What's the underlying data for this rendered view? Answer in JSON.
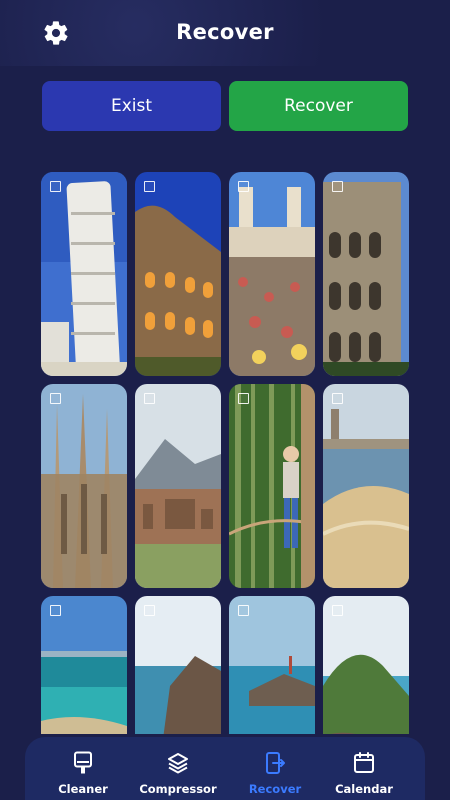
{
  "header": {
    "title": "Recover",
    "settings_icon": "gear-icon"
  },
  "actions": {
    "exist_label": "Exist",
    "recover_label": "Recover"
  },
  "colors": {
    "background": "#1b1f4a",
    "exist_button": "#2b38b0",
    "recover_button": "#23a547",
    "nav_background": "#1e2a63",
    "active_tab": "#3b7bff"
  },
  "gallery": {
    "photos": [
      {
        "subject": "leaning-tower-of-pisa",
        "selected": false
      },
      {
        "subject": "colosseum-at-dusk",
        "selected": false
      },
      {
        "subject": "spanish-steps-crowd",
        "selected": false
      },
      {
        "subject": "colosseum-facade",
        "selected": false
      },
      {
        "subject": "sagrada-familia",
        "selected": false
      },
      {
        "subject": "pompeii-ruins-vesuvius",
        "selected": false
      },
      {
        "subject": "woman-on-rope-bridge",
        "selected": false
      },
      {
        "subject": "beach-with-tower",
        "selected": false
      },
      {
        "subject": "turquoise-beach",
        "selected": false
      },
      {
        "subject": "rocky-coast",
        "selected": false
      },
      {
        "subject": "rocks-in-sea",
        "selected": false
      },
      {
        "subject": "green-headland",
        "selected": false
      }
    ]
  },
  "nav": {
    "items": [
      {
        "label": "Cleaner",
        "icon": "cleaner-icon",
        "active": false
      },
      {
        "label": "Compressor",
        "icon": "layers-icon",
        "active": false
      },
      {
        "label": "Recover",
        "icon": "phone-recover-icon",
        "active": true
      },
      {
        "label": "Calendar",
        "icon": "calendar-icon",
        "active": false
      }
    ]
  }
}
